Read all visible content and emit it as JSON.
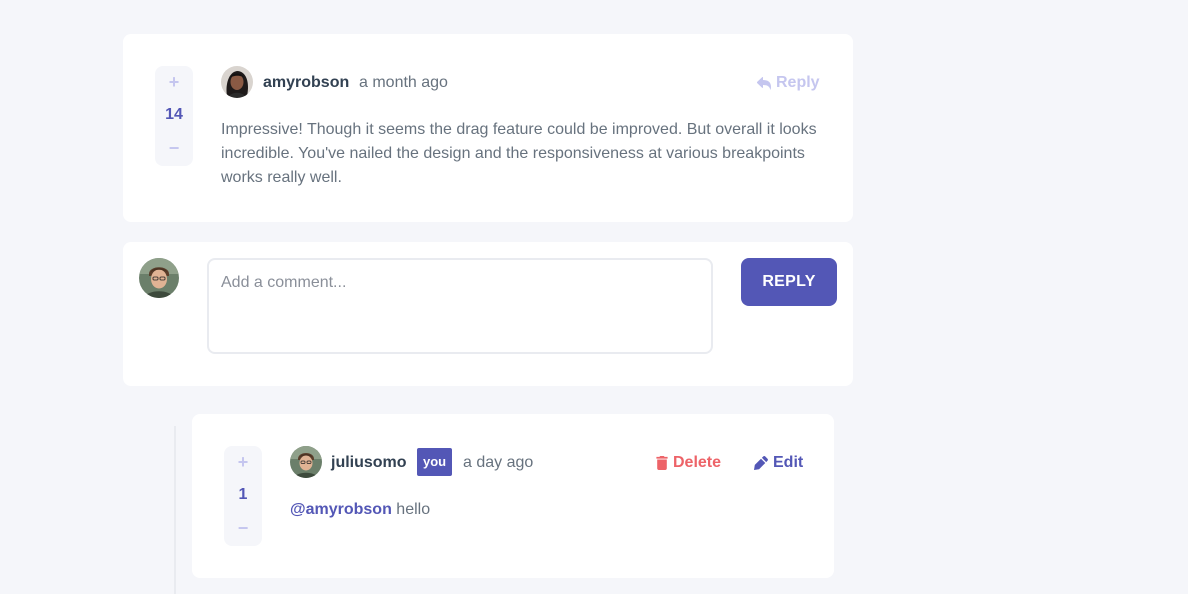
{
  "comment": {
    "score": "14",
    "upvote_symbol": "+",
    "downvote_symbol": "−",
    "username": "amyrobson",
    "created_at": "a month ago",
    "reply_label": "Reply",
    "reply_color": "#c5c6ef",
    "text": "Impressive! Though it seems the drag feature could be improved. But overall it looks incredible. You've nailed the design and the responsiveness at various breakpoints works really well."
  },
  "reply_form": {
    "placeholder": "Add a comment...",
    "submit_label": "REPLY"
  },
  "reply": {
    "score": "1",
    "upvote_symbol": "+",
    "downvote_symbol": "−",
    "username": "juliusomo",
    "you_badge": "you",
    "created_at": "a day ago",
    "delete_label": "Delete",
    "edit_label": "Edit",
    "mention": "@amyrobson",
    "text": " hello"
  },
  "colors": {
    "primary": "#5357b6",
    "danger": "#ed6368",
    "background": "#f5f6fa",
    "muted_accent": "#c5c6ef"
  },
  "icons": {
    "reply": "reply-arrow-icon",
    "delete": "trash-icon",
    "edit": "pencil-icon"
  }
}
